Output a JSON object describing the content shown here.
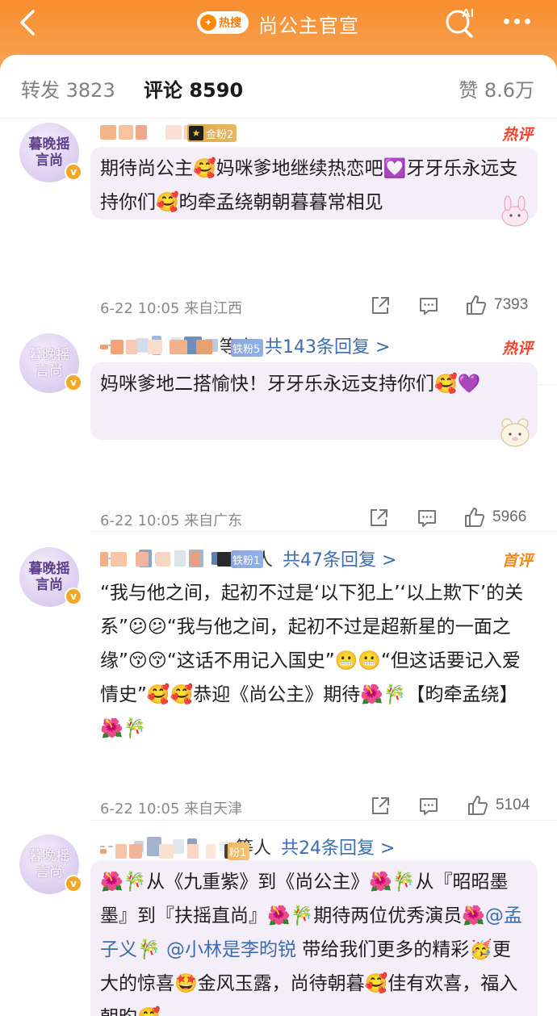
{
  "header": {
    "hot_badge": "热搜",
    "title": "尚公主官宣"
  },
  "tabs": {
    "reposts_label": "转发",
    "reposts_count": "3823",
    "comments_label": "评论",
    "comments_count": "8590",
    "likes_label": "赞",
    "likes_count": "8.6万"
  },
  "comments": [
    {
      "avatar_lines": [
        "暮晚摇",
        "言尚"
      ],
      "fan_badge": "金粉2",
      "tag": "热评",
      "text": "期待尚公主🥰妈咪爹地继续热恋吧💟牙牙乐永远支持你们🥰昀牵孟绕朝朝暮暮常相见",
      "time": "6-22 10:05",
      "location": "来自江西",
      "likes": "7393",
      "replies_suffix": "等人",
      "replies_total": "共143条回复 >"
    },
    {
      "avatar_lines": [
        "暮晚摇",
        "言尚"
      ],
      "fan_badge": "铁粉5",
      "tag": "热评",
      "text": "妈咪爹地二搭愉快！牙牙乐永远支持你们🥰💜",
      "time": "6-22 10:05",
      "location": "来自广东",
      "likes": "5966",
      "replies_suffix": "等人",
      "replies_total": "共47条回复 >"
    },
    {
      "avatar_lines": [
        "暮晚摇",
        "言尚"
      ],
      "fan_badge": "铁粉1",
      "tag": "首评",
      "text": "“我与他之间，起初不过是‘以下犯上’‘以上欺下’的关系”😕😕“我与他之间，起初不过是超新星的一面之缘”😚😚“这话不用记入国史”😬😬“但这话要记入爱情史”🥰🥰恭迎《尚公主》期待🌺🎋【昀牵孟绕】🌺🎋",
      "time": "6-22 10:05",
      "location": "来自天津",
      "likes": "5104",
      "replies_suffix": "等人",
      "replies_total": "共24条回复 >"
    },
    {
      "avatar_lines": [
        "暮晚摇",
        "言尚"
      ],
      "fan_badge": "粉1",
      "text_before": "🌺🎋从《九重紫》到《尚公主》🌺🎋从『昭昭墨墨』到『扶摇直尚』🌺🎋期待两位优秀演员🌺",
      "mention1": "@孟子义",
      "text_mid": "🎋 ",
      "mention2": "@小林是李昀锐",
      "text_after": " 带给我们更多的精彩🥳更大的惊喜🤩金风玉露，尚待朝暮🥰佳有欢喜，福入朝昀🥰"
    }
  ]
}
